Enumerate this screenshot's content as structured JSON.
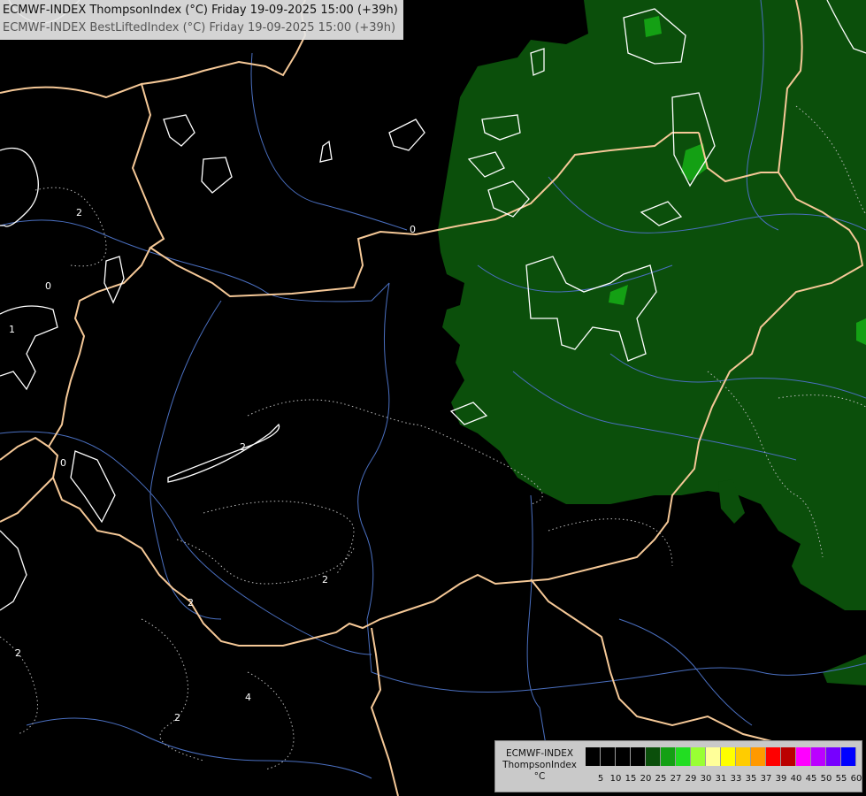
{
  "title": {
    "line1": "ECMWF-INDEX ThompsonIndex (°C) Friday 19-09-2025 15:00 (+39h)",
    "line2": "ECMWF-INDEX BestLiftedIndex (°C) Friday 19-09-2025 15:00 (+39h)"
  },
  "contour_labels": {
    "c1": "0",
    "c2": "0",
    "c3": "2",
    "c4": "0",
    "c5": "1",
    "c6": "2",
    "c7": "2",
    "c8": "2",
    "c9": "2",
    "c10": "4",
    "c11": "2"
  },
  "legend": {
    "line1": "ECMWF-INDEX",
    "line2": "ThompsonIndex",
    "line3": "°C",
    "colors": [
      "#000000",
      "#000000",
      "#000000",
      "#000000",
      "#0b4f0b",
      "#14a014",
      "#22dd22",
      "#99ff33",
      "#ffff99",
      "#ffff00",
      "#ffcc00",
      "#ff9900",
      "#ff0000",
      "#bb0000",
      "#ff00ff",
      "#bb00ff",
      "#7700ff",
      "#0000ff"
    ],
    "ticks": [
      "5",
      "10",
      "15",
      "20",
      "25",
      "27",
      "29",
      "30",
      "31",
      "33",
      "35",
      "37",
      "39",
      "40",
      "45",
      "50",
      "55",
      "60"
    ]
  },
  "colors": {
    "background": "#000000",
    "ti_20_25": "#0b4f0b",
    "ti_25_27": "#14a014",
    "border": "#f5c897",
    "river": "#4a6fc0"
  }
}
